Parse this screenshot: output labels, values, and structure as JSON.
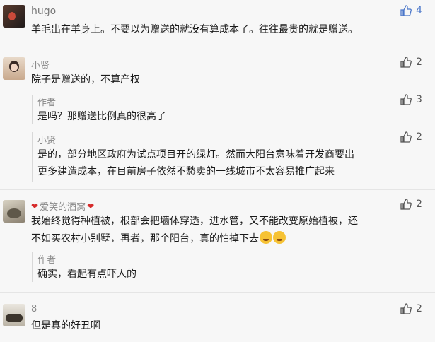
{
  "comments": [
    {
      "user": "hugo",
      "text": "羊毛出在羊身上。不要以为赠送的就没有算成本了。往往最贵的就是赠送。",
      "likes": "4",
      "liked": true
    },
    {
      "user": "小贤",
      "text": "院子是赠送的，不算产权",
      "likes": "2",
      "replies": [
        {
          "user": "作者",
          "text": "是吗？那赠送比例真的很高了",
          "likes": "3"
        },
        {
          "user": "小贤",
          "lines": [
            "是的，部分地区政府为试点项目开的绿灯。然而大阳台意味着开发商要出",
            "更多建造成本，在目前房子依然不愁卖的一线城市不太容易推广起来"
          ],
          "likes": "2"
        }
      ]
    },
    {
      "user": "爱笑的酒窝",
      "lines": [
        "我始终觉得种植被，根部会把墙体穿透，进水管，又不能改变原始植被，还",
        "不如买农村小别墅，再者，那个阳台，真的怕掉下去"
      ],
      "likes": "2",
      "replies": [
        {
          "user": "作者",
          "text": "确实，看起有点吓人的"
        }
      ]
    },
    {
      "user": "8",
      "text": "但是真的好丑啊",
      "likes": "2"
    }
  ],
  "icons": {
    "like": "thumbs-up-icon",
    "heart": "heart-icon",
    "emoji": "laughing-crying-emoji"
  },
  "colors": {
    "liked": "#4a76c9",
    "unliked": "#555555",
    "heart": "#d62b2b"
  }
}
